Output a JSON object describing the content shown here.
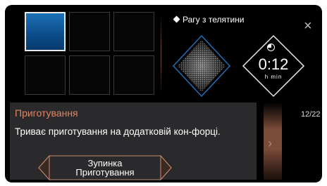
{
  "recipe": {
    "name": "Рагу з телятини"
  },
  "timer": {
    "value": "0:12",
    "units": "h  min"
  },
  "panel": {
    "title": "Приготування",
    "message": "Триває приготування на додатковій кон-форці.",
    "stop_line1": "Зупинка",
    "stop_line2": "Приготування"
  },
  "pager": "12/22",
  "colors": {
    "accent": "#e3855f",
    "zone_active": "#1c6fb5",
    "panel": "#2a2a2c",
    "copper": "#7a4b39"
  },
  "icons": {
    "close": "close-icon",
    "timer": "clock-icon",
    "recipe": "diamond-bullet-icon",
    "scroll": "chevron-right-icon"
  }
}
